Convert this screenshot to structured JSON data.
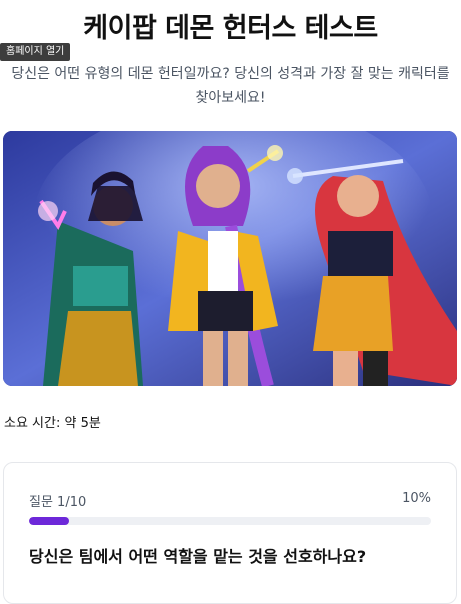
{
  "page": {
    "title": "케이팝 데몬 헌터스 테스트",
    "home_tooltip": "홈페이지 열기",
    "subtitle": "당신은 어떤 유형의 데몬 헌터일까요? 당신의 성격과 가장 잘 맞는 캐릭터를 찾아보세요!",
    "duration": "소요 시간: 약 5분"
  },
  "quiz": {
    "question_label": "질문 1/10",
    "progress_label": "10%",
    "progress": 0.1,
    "question": "당신은 팀에서 어떤 역할을 맡는 것을 선호하나요?"
  },
  "colors": {
    "accent": "#6d28d9",
    "track": "#eef0f4"
  }
}
